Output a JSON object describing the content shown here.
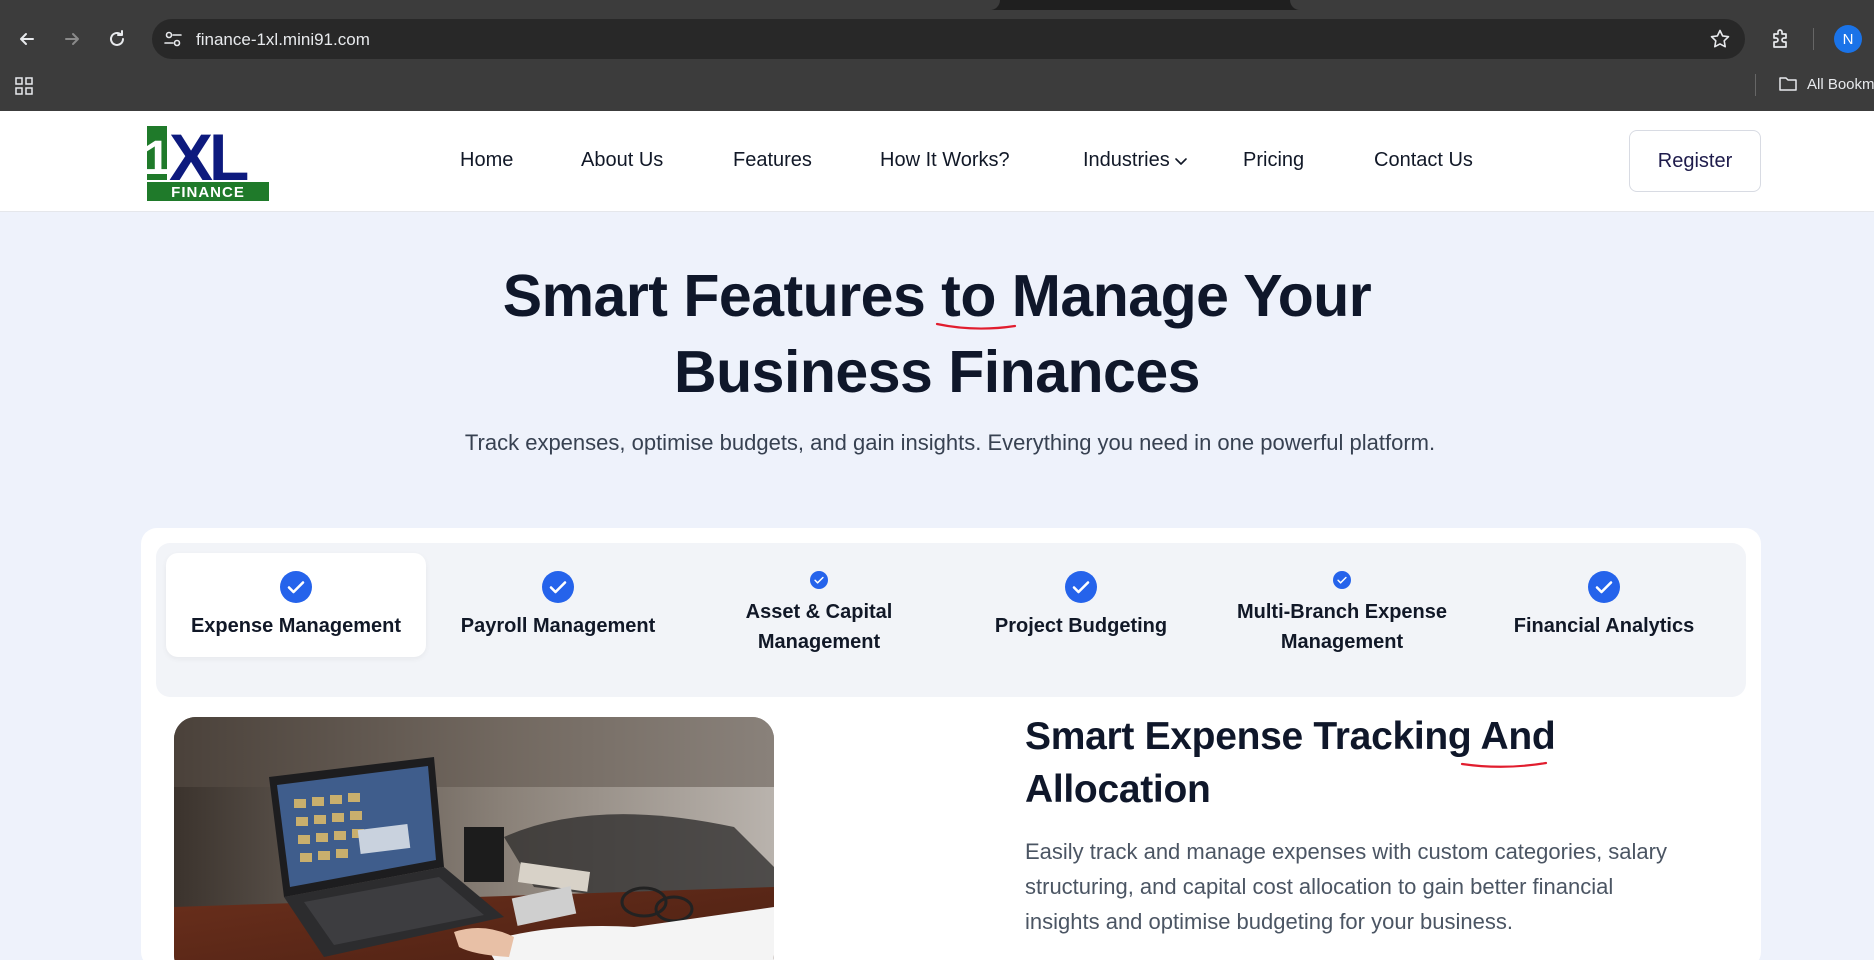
{
  "browser": {
    "url": "finance-1xl.mini91.com",
    "profile_initial": "N",
    "bookmarks_label": "All Bookm",
    "icons": [
      "back-icon",
      "forward-icon",
      "reload-icon",
      "site-settings-icon",
      "star-icon",
      "extensions-icon",
      "apps-icon",
      "folder-icon"
    ]
  },
  "header": {
    "logo": {
      "mark": "1XL",
      "sub": "FINANCE"
    },
    "nav": [
      "Home",
      "About Us",
      "Features",
      "How It Works?",
      "Industries",
      "Pricing",
      "Contact Us"
    ],
    "register_label": "Register"
  },
  "hero": {
    "title_line1": "Smart Features to Manage Your",
    "title_line2": "Business Finances",
    "subtitle": "Track expenses, optimise budgets, and gain insights. Everything you need in one powerful platform."
  },
  "features": {
    "tabs": [
      {
        "label": "Expense Management",
        "active": true
      },
      {
        "label": "Payroll Management",
        "active": false
      },
      {
        "label": "Asset & Capital Management",
        "active": false
      },
      {
        "label": "Project Budgeting",
        "active": false
      },
      {
        "label": "Multi-Branch Expense Management",
        "active": false
      },
      {
        "label": "Financial Analytics",
        "active": false
      }
    ],
    "content": {
      "title": "Smart Expense Tracking And Allocation",
      "text": "Easily track and manage expenses with custom categories, salary structuring, and capital cost allocation to gain better financial insights and optimise budgeting for your business."
    }
  },
  "colors": {
    "accent": "#2563eb",
    "page_bg": "#eef2fb",
    "heading": "#0f172a",
    "logo_green": "#1f7a2a",
    "logo_navy": "#0d1a7e"
  }
}
